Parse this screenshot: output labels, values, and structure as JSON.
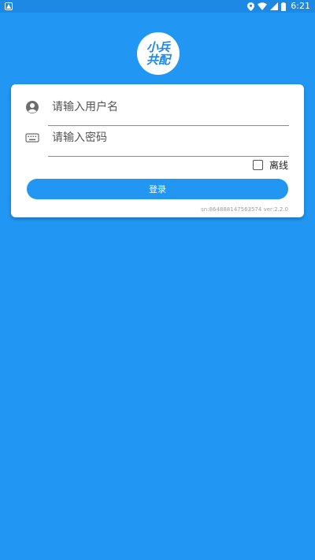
{
  "statusbar": {
    "time": "6:21",
    "left_icon": "app-notification-icon",
    "icons": [
      "location-icon",
      "wifi-icon",
      "signal-icon",
      "battery-icon"
    ]
  },
  "logo": {
    "line1": "小兵",
    "line2": "共配",
    "color": "#1E88E5"
  },
  "login_form": {
    "username_placeholder": "请输入用户名",
    "username_icon": "user-avatar-icon",
    "password_placeholder": "请输入密码",
    "password_icon": "keyboard-icon",
    "offline_label": "离线",
    "offline_checked": false,
    "login_label": "登录",
    "version_text": "sn:864888147563574 ver:2.2.0"
  },
  "colors": {
    "background": "#2196F3",
    "statusbar": "#1E88E5",
    "button": "#2196F3"
  }
}
